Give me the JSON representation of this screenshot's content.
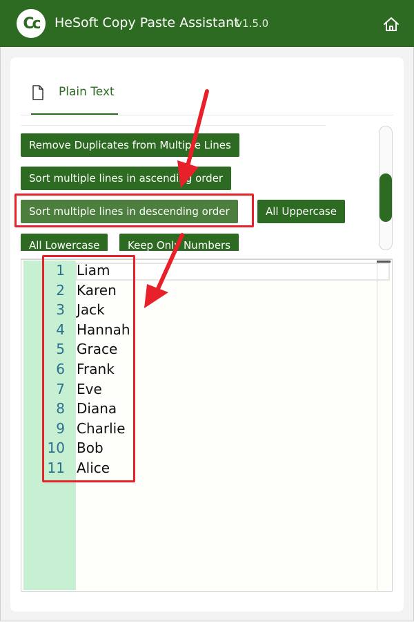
{
  "app": {
    "title": "HeSoft Copy Paste Assistant",
    "version": "- v1.5.0",
    "logo_text": "Cc",
    "icons": {
      "logo": "app-logo",
      "home": "home-icon"
    }
  },
  "tabs": [
    {
      "label": "Plain Text",
      "icon": "document-icon",
      "selected": true
    }
  ],
  "buttons": [
    {
      "label": "Remove Duplicates from Multiple Lines"
    },
    {
      "label": "Sort multiple lines in ascending order"
    },
    {
      "label": "Sort multiple lines in descending order",
      "highlighted": true
    },
    {
      "label": "All Uppercase"
    },
    {
      "label": "All Lowercase"
    },
    {
      "label": "Keep Only Numbers"
    }
  ],
  "editor": {
    "line_numbers": [
      "1",
      "2",
      "3",
      "4",
      "5",
      "6",
      "7",
      "8",
      "9",
      "10",
      "11"
    ],
    "lines": [
      "Liam",
      "Karen",
      "Jack",
      "Hannah",
      "Grace",
      "Frank",
      "Eve",
      "Diana",
      "Charlie",
      "Bob",
      "Alice"
    ]
  },
  "colors": {
    "brand_green": "#2e6b22",
    "active_button": "#4c7f3e",
    "gutter": "#c6f0d1",
    "annotation_red": "#e8202a",
    "line_number": "#2b6f8f"
  }
}
